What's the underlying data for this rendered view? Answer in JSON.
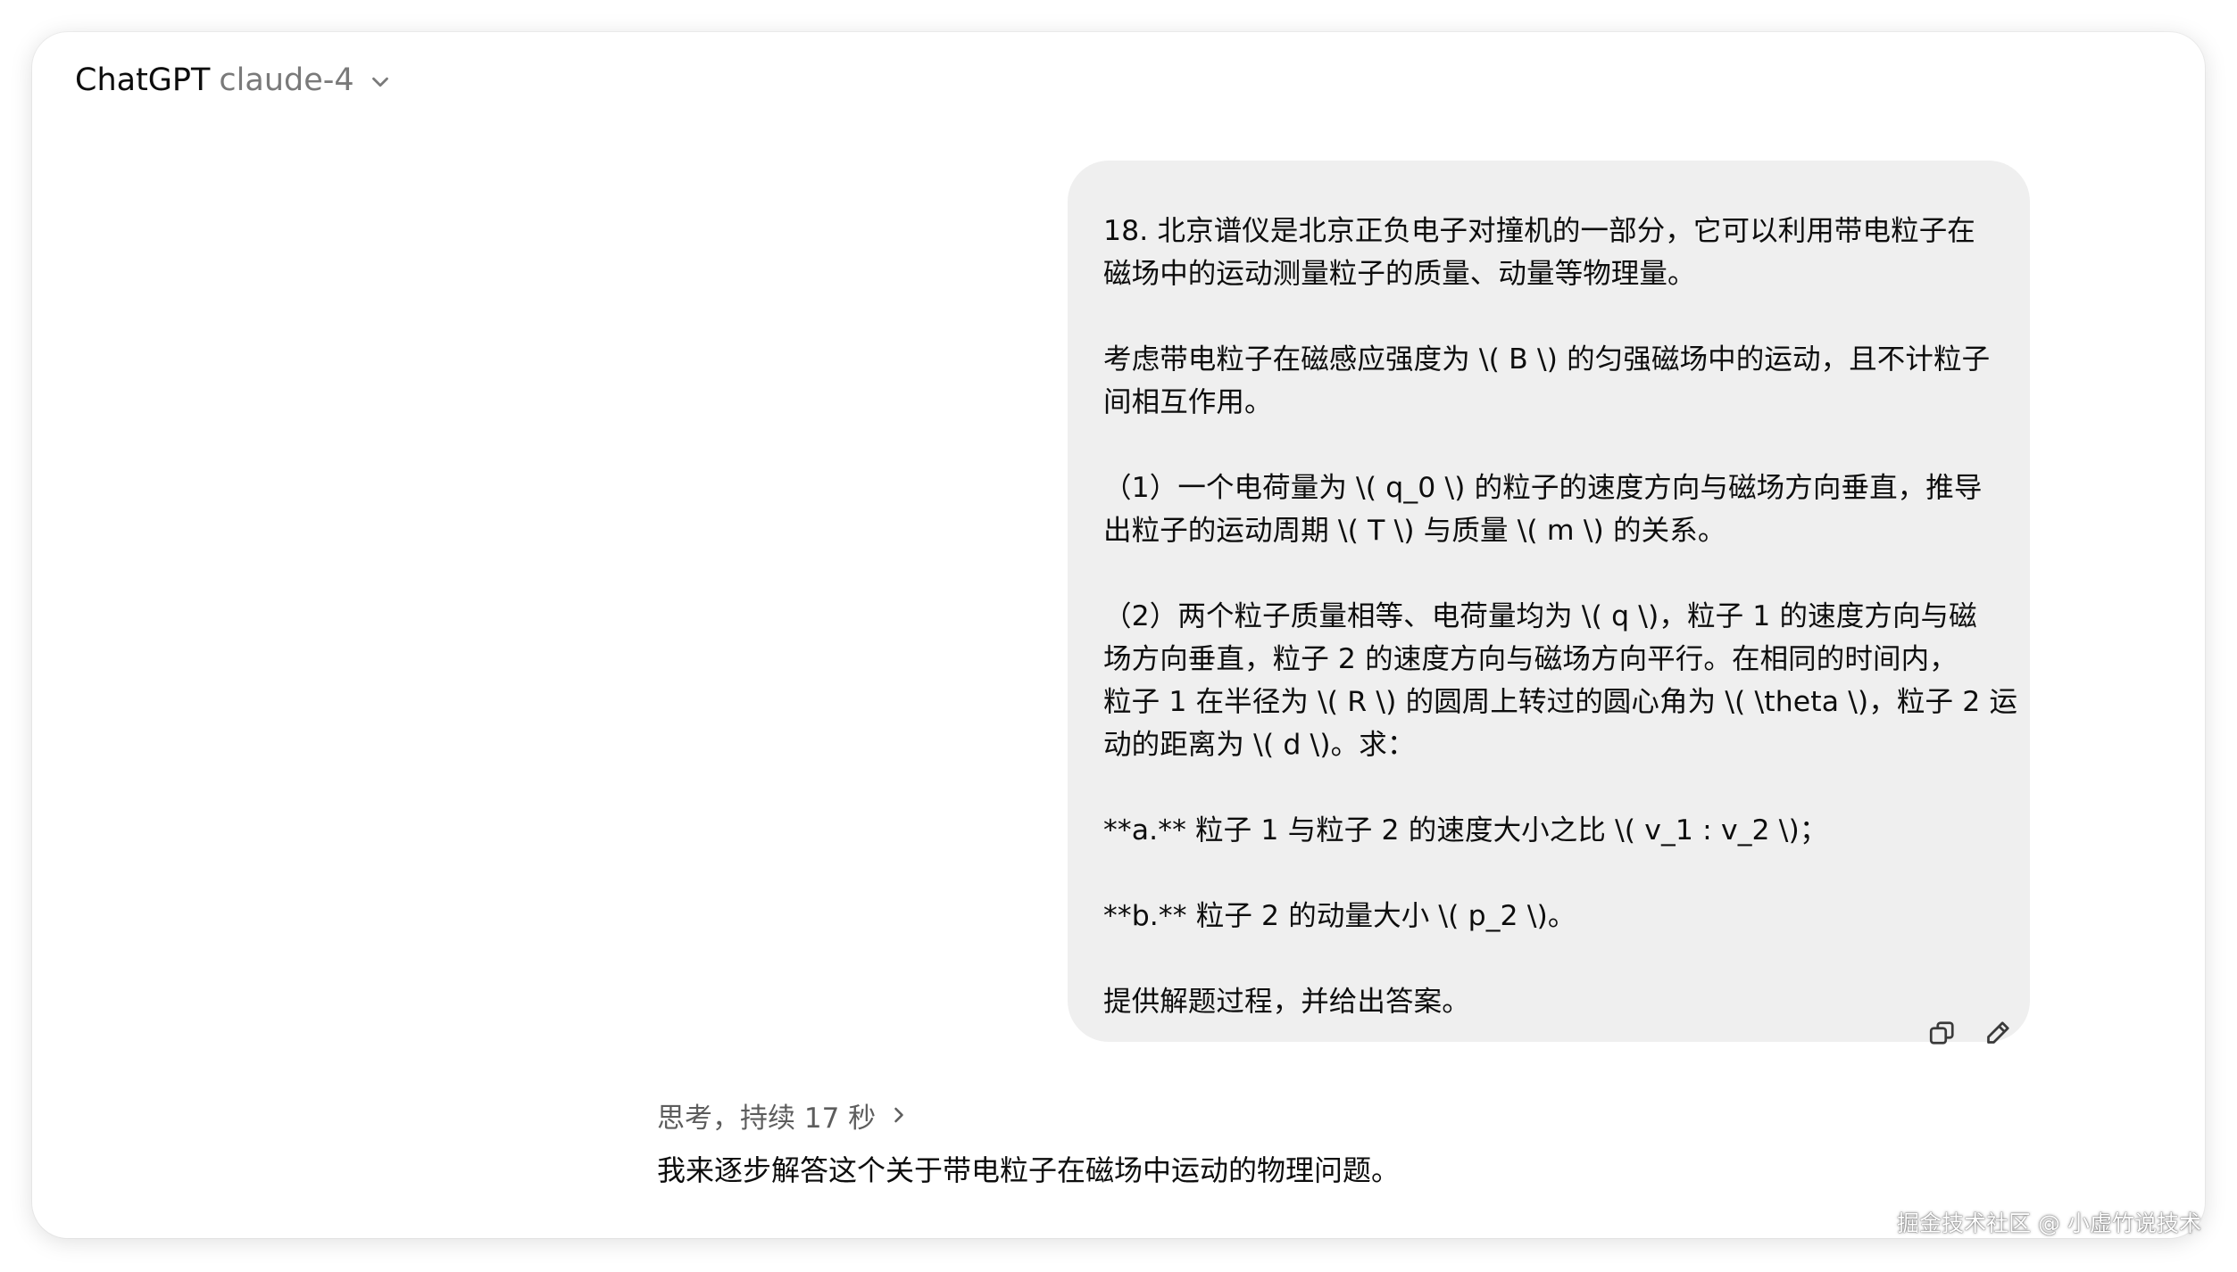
{
  "header": {
    "app_title": "ChatGPT",
    "model_name": "claude-4"
  },
  "user_message": {
    "lines": [
      "18. 北京谱仪是北京正负电子对撞机的一部分，它可以利用带电粒子在",
      "磁场中的运动测量粒子的质量、动量等物理量。",
      "",
      "考虑带电粒子在磁感应强度为 \\( B \\) 的匀强磁场中的运动，且不计粒子",
      "间相互作用。",
      "",
      "（1）一个电荷量为 \\( q_0 \\) 的粒子的速度方向与磁场方向垂直，推导",
      "出粒子的运动周期 \\( T \\) 与质量 \\( m \\) 的关系。",
      "",
      "（2）两个粒子质量相等、电荷量均为 \\( q \\)，粒子 1 的速度方向与磁",
      "场方向垂直，粒子 2 的速度方向与磁场方向平行。在相同的时间内，",
      "粒子 1 在半径为 \\( R \\) 的圆周上转过的圆心角为 \\( \\theta \\)，粒子 2 运",
      "动的距离为 \\( d \\)。求：",
      "",
      "**a.** 粒子 1 与粒子 2 的速度大小之比 \\( v_1 : v_2 \\)；",
      "",
      "**b.** 粒子 2 的动量大小 \\( p_2 \\)。",
      "",
      "提供解题过程，并给出答案。"
    ]
  },
  "message_actions": {
    "copy_icon": "copy-icon",
    "edit_icon": "pencil-icon"
  },
  "thinking": {
    "label": "思考，持续 17 秒",
    "icon": "chevron-right-icon"
  },
  "assistant_message": {
    "text": "我来逐步解答这个关于带电粒子在磁场中运动的物理问题。"
  },
  "watermark": {
    "text": "掘金技术社区 @ 小虚竹说技术"
  },
  "colors": {
    "bubble_bg": "#efefef",
    "text": "#0d0d0d",
    "muted": "#7a7a7a"
  }
}
